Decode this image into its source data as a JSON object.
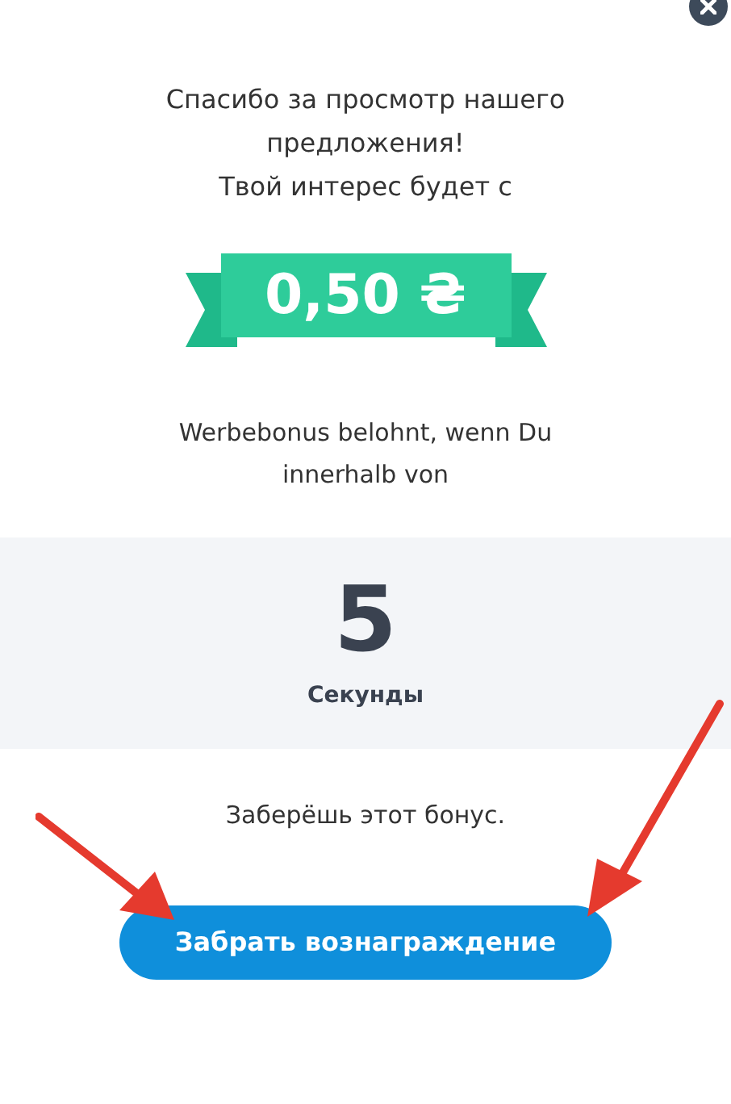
{
  "intro_lines": [
    "Спасибо за просмотр нашего",
    "предложения!",
    "Твой интерес будет с"
  ],
  "bonus_amount": "0,50 ₴",
  "middle_lines": [
    "Werbebonus belohnt, wenn Du",
    "innerhalb von"
  ],
  "countdown": {
    "value": "5",
    "unit": "Секунды"
  },
  "footer_text": "Заберёшь этот бонус.",
  "claim_button": "Забрать вознаграждение"
}
